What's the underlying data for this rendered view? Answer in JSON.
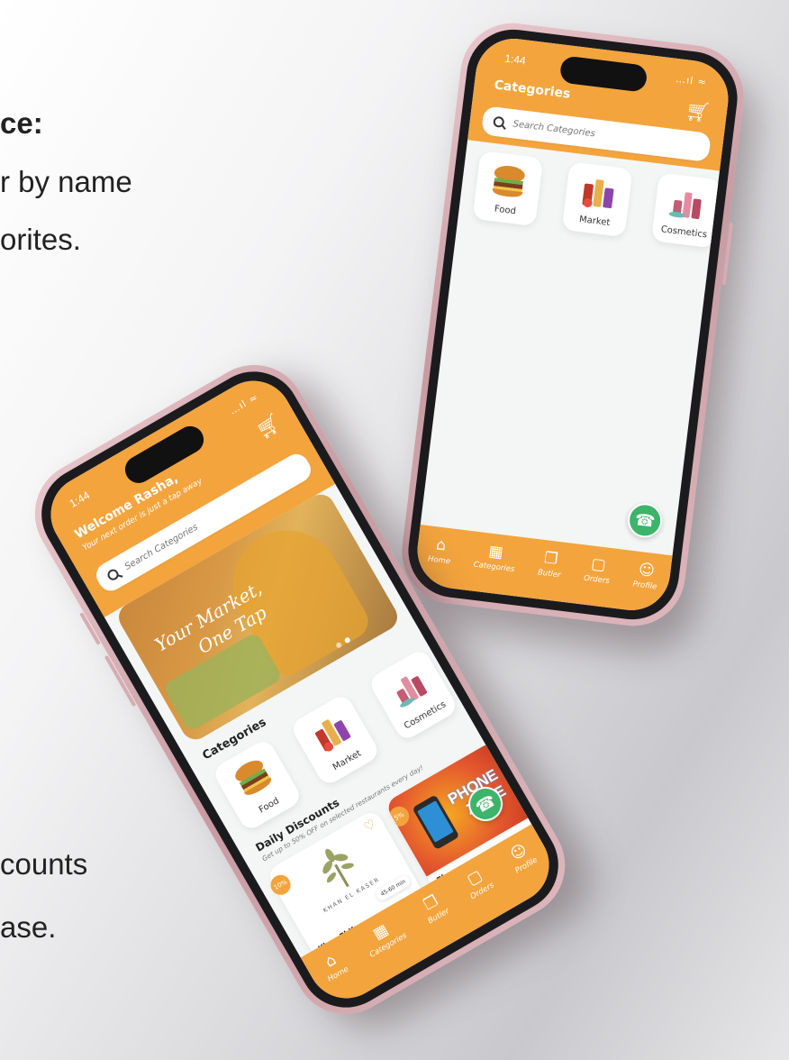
{
  "background_text": [
    "ce:",
    "r by name",
    "orites.",
    "counts",
    "ase."
  ],
  "colors": {
    "accent": "#f3a43d",
    "whatsapp": "#3cb46a"
  },
  "phone_right": {
    "time": "1:44",
    "signal": "…ıl ≈",
    "title": "Categories",
    "cart_icon": "cart-icon",
    "search_placeholder": "Search Categories",
    "categories": [
      {
        "label": "Food"
      },
      {
        "label": "Market"
      },
      {
        "label": "Cosmetics"
      }
    ],
    "whatsapp_icon": "whatsapp-icon",
    "tabs": [
      {
        "label": "Home",
        "icon": "home-icon",
        "glyph": "⌂"
      },
      {
        "label": "Categories",
        "icon": "grid-icon",
        "glyph": "▦"
      },
      {
        "label": "Butler",
        "icon": "gift-icon",
        "glyph": "❐"
      },
      {
        "label": "Orders",
        "icon": "bag-icon",
        "glyph": "▢"
      },
      {
        "label": "Profile",
        "icon": "user-icon",
        "glyph": "☺"
      }
    ]
  },
  "phone_left": {
    "time": "1:44",
    "signal": "…ıl ≈",
    "welcome": "Welcome Rasha,",
    "subtitle": "Your next order is just a tap away",
    "search_placeholder": "Search Categories",
    "banner_line1": "Your Market,",
    "banner_line2": "One Tap",
    "banner_dots": 2,
    "banner_active_dot": 1,
    "categories_title": "Categories",
    "categories": [
      {
        "label": "Food"
      },
      {
        "label": "Market"
      },
      {
        "label": "Cosmetics"
      }
    ],
    "daily_title": "Daily Discounts",
    "daily_subtitle": "Get up to 50% OFF on selected restaurants every day!",
    "deals": [
      {
        "name": "Khan El Kaser",
        "badge": "10%",
        "time": "45-60 min",
        "logo_text": "KHAN EL KASER"
      },
      {
        "name": "Phone zone",
        "badge": "5%",
        "logo_line1": "PHONE",
        "logo_line2": "ZONE"
      }
    ],
    "tabs": [
      {
        "label": "Home",
        "icon": "home-icon",
        "glyph": "⌂"
      },
      {
        "label": "Categories",
        "icon": "grid-icon",
        "glyph": "▦"
      },
      {
        "label": "Butler",
        "icon": "gift-icon",
        "glyph": "❐"
      },
      {
        "label": "Orders",
        "icon": "bag-icon",
        "glyph": "▢"
      },
      {
        "label": "Profile",
        "icon": "user-icon",
        "glyph": "☺"
      }
    ]
  }
}
